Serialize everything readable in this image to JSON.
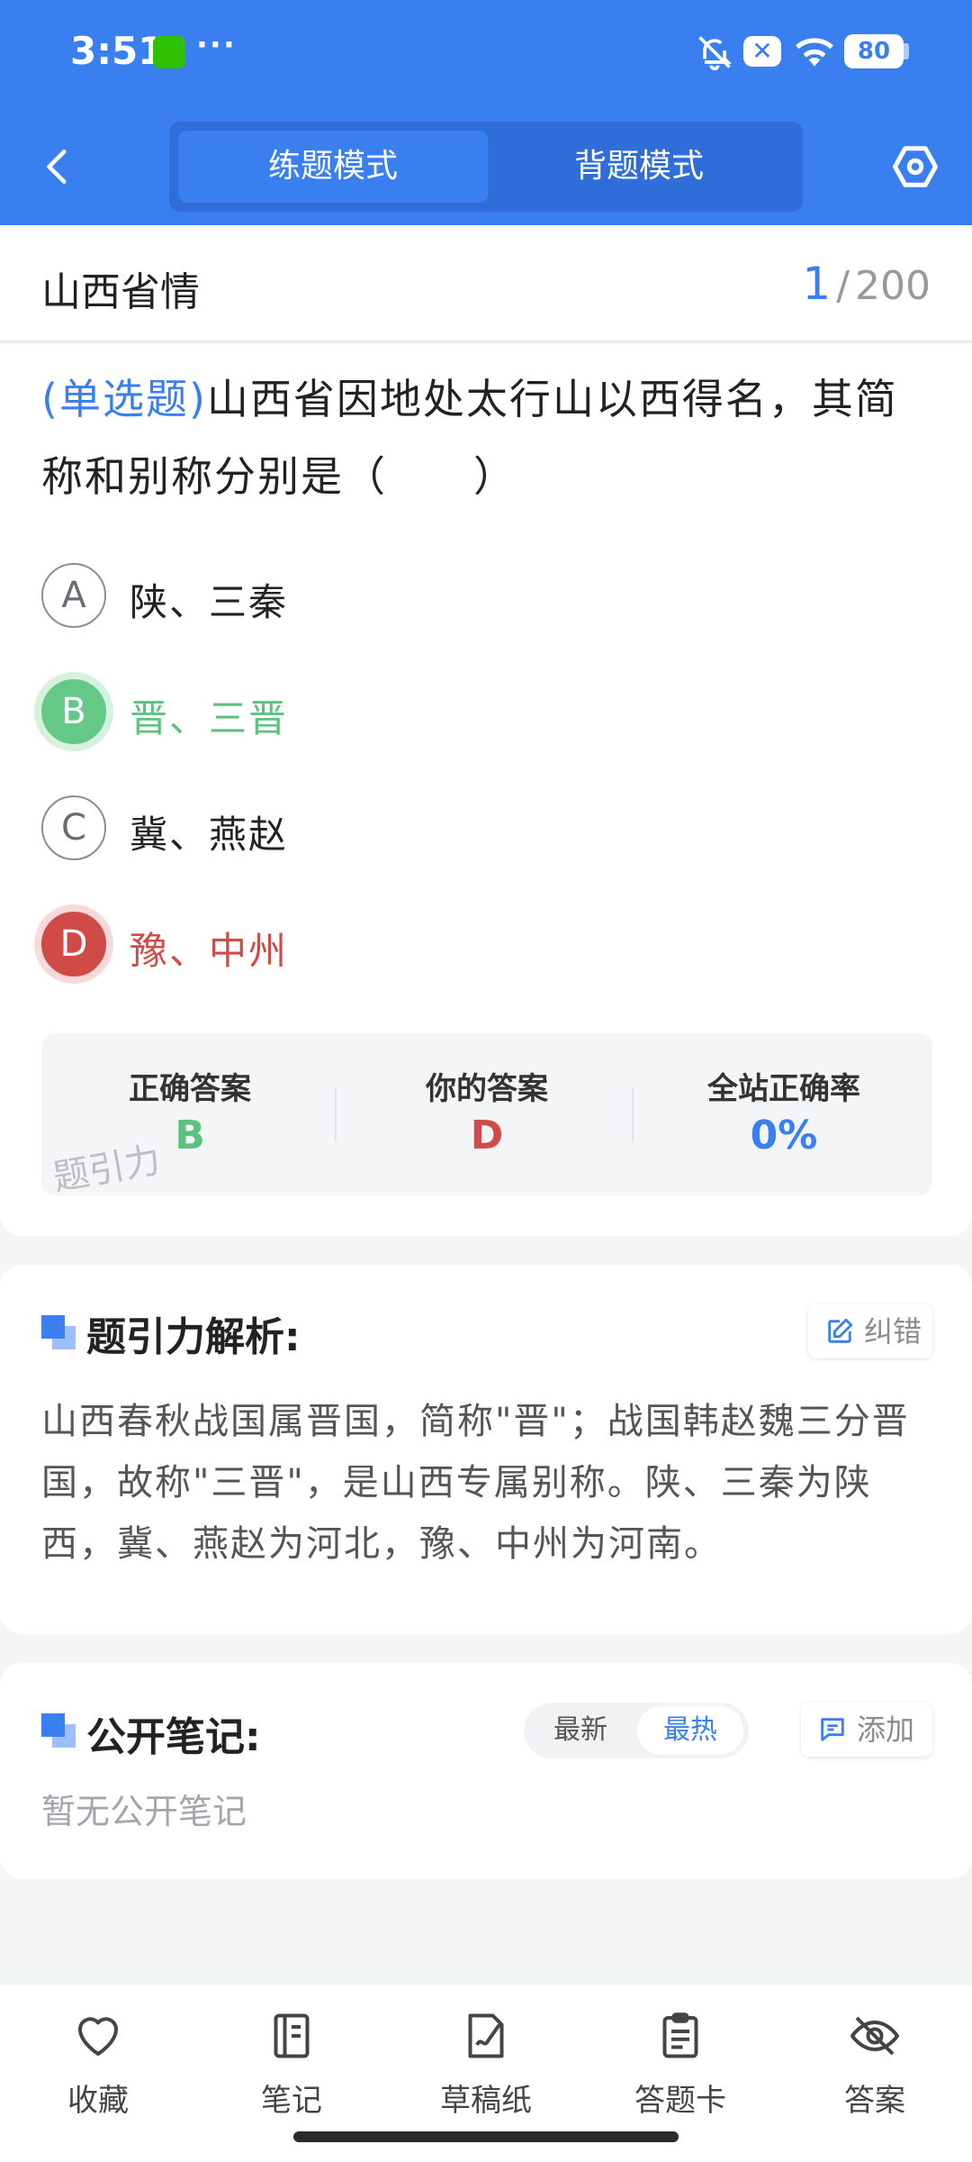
{
  "status_bar": {
    "time": "3:51",
    "more": "···",
    "battery": "80"
  },
  "header": {
    "modes": [
      "练题模式",
      "背题模式"
    ],
    "active_mode": "练题模式"
  },
  "section": {
    "title": "山西省情",
    "current": "1",
    "separator": "/",
    "total": "200"
  },
  "question": {
    "type": "(单选题)",
    "text": "山西省因地处太行山以西得名，其简称和别称分别是（　　）",
    "options": [
      {
        "letter": "A",
        "text": "陕、三秦",
        "state": "normal"
      },
      {
        "letter": "B",
        "text": "晋、三晋",
        "state": "correct"
      },
      {
        "letter": "C",
        "text": "冀、燕赵",
        "state": "normal"
      },
      {
        "letter": "D",
        "text": "豫、中州",
        "state": "wrong"
      }
    ]
  },
  "result": {
    "correct_label": "正确答案",
    "correct_value": "B",
    "yours_label": "你的答案",
    "yours_value": "D",
    "rate_label": "全站正确率",
    "rate_value": "0%",
    "watermark": "题引力",
    "colors": {
      "correct": "#5ec27f",
      "wrong": "#d04a47",
      "rate": "#3a7ff0"
    }
  },
  "analysis": {
    "heading": "题引力解析:",
    "report_label": "纠错",
    "text": "山西春秋战国属晋国，简称\"晋\"；战国韩赵魏三分晋国，故称\"三晋\"，是山西专属别称。陕、三秦为陕西，冀、燕赵为河北，豫、中州为河南。"
  },
  "notes": {
    "heading": "公开笔记:",
    "sort_options": [
      "最新",
      "最热"
    ],
    "active_sort": "最热",
    "add_label": "添加",
    "empty_text": "暂无公开笔记"
  },
  "bottom_tabs": [
    {
      "label": "收藏",
      "icon": "heart-icon"
    },
    {
      "label": "笔记",
      "icon": "notebook-icon"
    },
    {
      "label": "草稿纸",
      "icon": "draft-paper-icon"
    },
    {
      "label": "答题卡",
      "icon": "answer-sheet-icon"
    },
    {
      "label": "答案",
      "icon": "eye-off-icon"
    }
  ],
  "theme": {
    "primary": "#3a7ff0",
    "background": "#f4f5f7"
  }
}
